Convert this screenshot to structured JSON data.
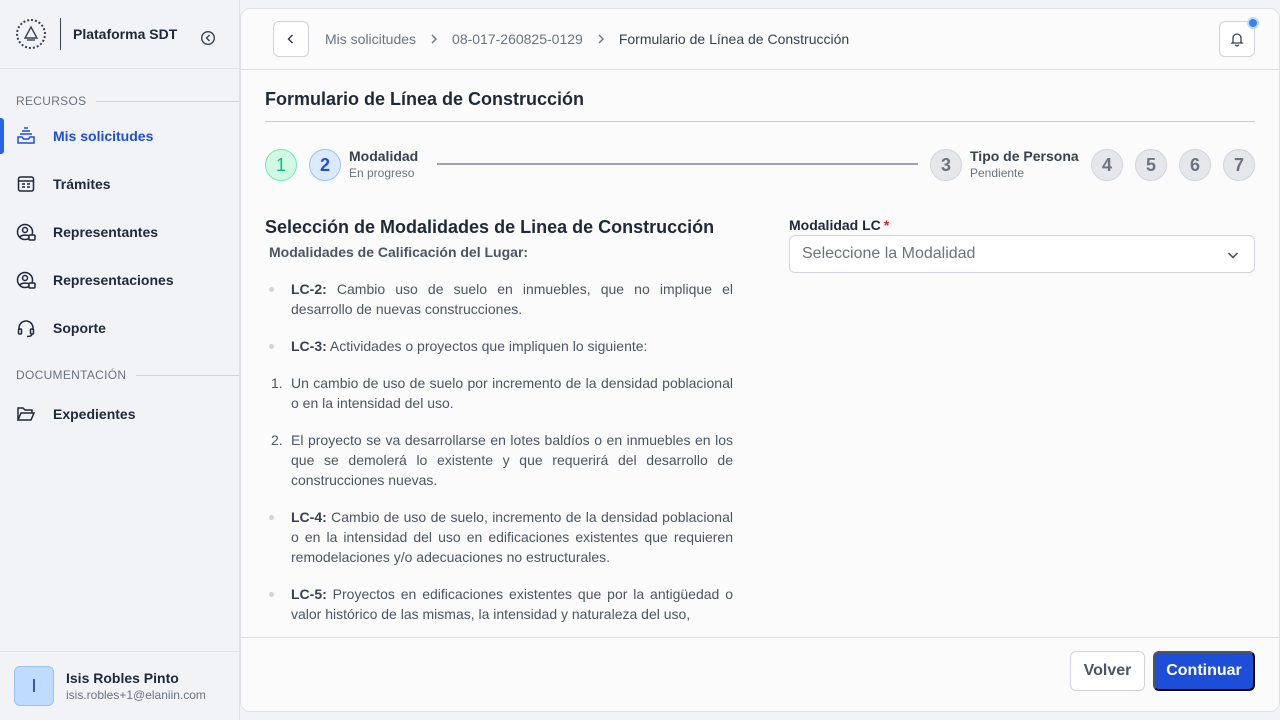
{
  "sidebar": {
    "app_name": "Plataforma SDT",
    "sections": {
      "resources": "RECURSOS",
      "documentation": "DOCUMENTACIÓN"
    },
    "items": [
      {
        "label": "Mis solicitudes",
        "icon": "inbox-stack-icon",
        "active": true
      },
      {
        "label": "Trámites",
        "icon": "form-grid-icon"
      },
      {
        "label": "Representantes",
        "icon": "user-circle-lock-icon"
      },
      {
        "label": "Representaciones",
        "icon": "user-circle-lock-icon"
      },
      {
        "label": "Soporte",
        "icon": "headset-icon"
      },
      {
        "label": "Expedientes",
        "icon": "folder-open-icon"
      }
    ],
    "user": {
      "initial": "I",
      "name": "Isis Robles Pinto",
      "email": "isis.robles+1@elaniin.com"
    }
  },
  "header": {
    "breadcrumb": [
      "Mis solicitudes",
      "08-017-260825-0129",
      "Formulario de Línea de Construcción"
    ]
  },
  "page": {
    "title": "Formulario de Línea de Construcción"
  },
  "stepper": {
    "steps": [
      {
        "number": "1",
        "status": "done"
      },
      {
        "number": "2",
        "title": "Modalidad",
        "subtitle": "En progreso",
        "status": "active"
      },
      {
        "number": "3",
        "title": "Tipo de Persona",
        "subtitle": "Pendiente",
        "status": "pending"
      },
      {
        "number": "4",
        "status": "pending"
      },
      {
        "number": "5",
        "status": "pending"
      },
      {
        "number": "6",
        "status": "pending"
      },
      {
        "number": "7",
        "status": "pending"
      }
    ]
  },
  "content": {
    "title": "Selección de Modalidades de Linea de Construcción",
    "subtitle": "Modalidades de Calificación del Lugar:",
    "items": [
      {
        "code": "LC-2:",
        "text": " Cambio uso de suelo en inmuebles, que no implique el desarrollo de nuevas construcciones."
      },
      {
        "code": "LC-3:",
        "text": " Actividades o proyectos que impliquen lo siguiente:"
      },
      {
        "num": "1.",
        "text": "Un cambio de uso de suelo por incremento de la densidad poblacional o en la intensidad del uso."
      },
      {
        "num": "2.",
        "text": "El proyecto se va desarrollarse en lotes baldíos o en inmuebles en los que se demolerá lo existente y que requerirá del desarrollo de construcciones nuevas."
      },
      {
        "code": "LC-4:",
        "text": " Cambio de uso de suelo, incremento de la densidad poblacional o en la intensidad del uso en edificaciones existentes que requieren remodelaciones y/o adecuaciones no estructurales."
      },
      {
        "code": "LC-5:",
        "text": " Proyectos en edificaciones existentes que por la antigüedad o valor histórico de las mismas, la intensidad y naturaleza del uso,"
      }
    ]
  },
  "form": {
    "modalidad_label": "Modalidad LC",
    "required_mark": "*",
    "modalidad_placeholder": "Seleccione la Modalidad"
  },
  "footer": {
    "back_label": "Volver",
    "continue_label": "Continuar"
  },
  "colors": {
    "primary": "#1d4ed8",
    "success": "#10b981",
    "required": "#dc2626"
  }
}
